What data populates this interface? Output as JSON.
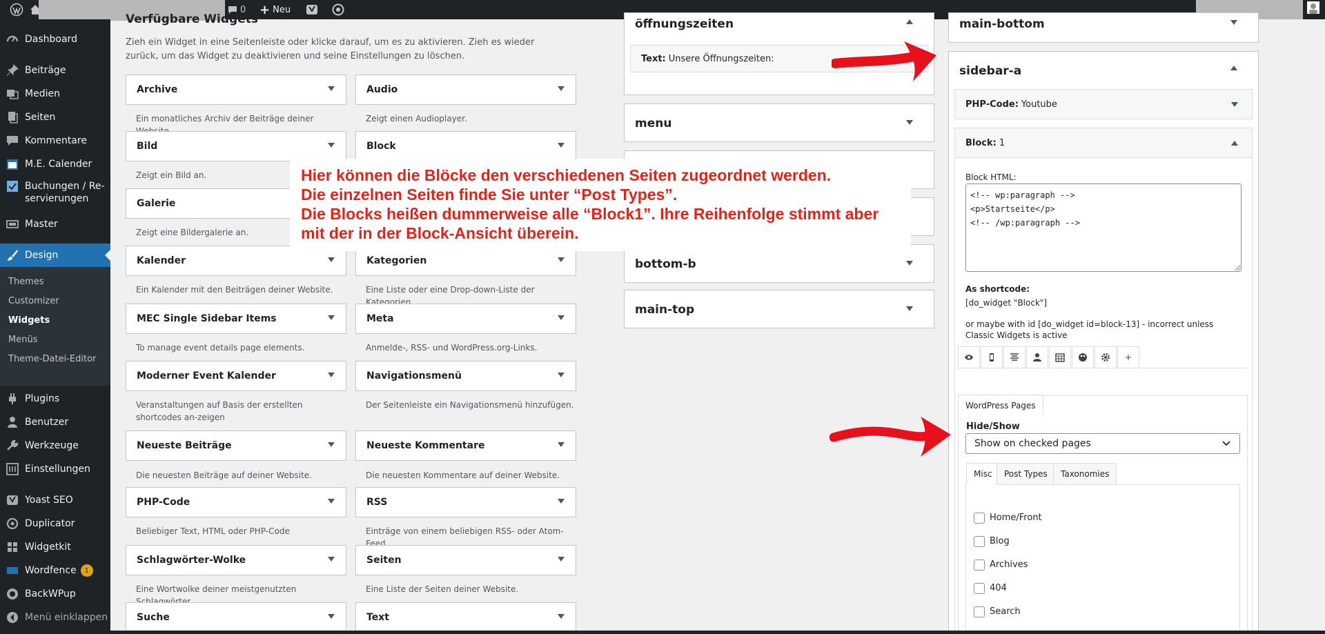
{
  "adminbar": {
    "comments": "0",
    "new_label": "Neu"
  },
  "menu": {
    "dashboard": "Dashboard",
    "posts": "Beiträge",
    "media": "Medien",
    "pages": "Seiten",
    "comments": "Kommentare",
    "mec": "M.E. Calender",
    "bookings": "Buchungen / Re-servierungen",
    "master": "Master",
    "design": "Design",
    "design_sub": {
      "themes": "Themes",
      "customizer": "Customizer",
      "widgets": "Widgets",
      "menus": "Menüs",
      "theme_editor": "Theme-Datei-Editor"
    },
    "plugins": "Plugins",
    "users": "Benutzer",
    "tools": "Werkzeuge",
    "settings": "Einstellungen",
    "yoast": "Yoast SEO",
    "duplicator": "Duplicator",
    "widgetkit": "Widgetkit",
    "wordfence": "Wordfence",
    "wordfence_badge": "1",
    "backwpup": "BackWPup",
    "collapse": "Menü einklappen"
  },
  "available": {
    "title": "Verfügbare Widgets",
    "description": "Zieh ein Widget in eine Seitenleiste oder klicke darauf, um es zu aktivieren. Zieh es wieder zurück, um das Widget zu deaktivieren und seine Einstellungen zu löschen.",
    "widgets": [
      {
        "name": "Archive",
        "desc": "Ein monatliches Archiv der Beiträge deiner Website."
      },
      {
        "name": "Audio",
        "desc": "Zeigt einen Audioplayer."
      },
      {
        "name": "Bild",
        "desc": "Zeigt ein Bild an."
      },
      {
        "name": "Block",
        "desc": ""
      },
      {
        "name": "Galerie",
        "desc": "Zeigt eine Bildergalerie an."
      },
      {
        "name": "",
        "desc": ""
      },
      {
        "name": "Kalender",
        "desc": "Ein Kalender mit den Beiträgen deiner Website."
      },
      {
        "name": "Kategorien",
        "desc": "Eine Liste oder eine Drop-down-Liste der Kategorien."
      },
      {
        "name": "MEC Single Sidebar Items",
        "desc": "To manage event details page elements."
      },
      {
        "name": "Meta",
        "desc": "Anmelde-, RSS- und WordPress.org-Links."
      },
      {
        "name": "Moderner Event Kalender",
        "desc": "Veranstaltungen auf Basis der erstellten shortcodes an-zeigen"
      },
      {
        "name": "Navigationsmenü",
        "desc": "Der Seitenleiste ein Navigationsmenü hinzufügen."
      },
      {
        "name": "Neueste Beiträge",
        "desc": "Die neuesten Beiträge auf deiner Website."
      },
      {
        "name": "Neueste Kommentare",
        "desc": "Die neuesten Kommentare auf deiner Website."
      },
      {
        "name": "PHP-Code",
        "desc": "Beliebiger Text, HTML oder PHP-Code"
      },
      {
        "name": "RSS",
        "desc": "Einträge von einem beliebigen RSS- oder Atom-Feed."
      },
      {
        "name": "Schlagwörter-Wolke",
        "desc": "Eine Wortwolke deiner meistgenutzten Schlagwörter."
      },
      {
        "name": "Seiten",
        "desc": "Eine Liste der Seiten deiner Website."
      },
      {
        "name": "Suche",
        "desc": ""
      },
      {
        "name": "Text",
        "desc": ""
      }
    ]
  },
  "middle": {
    "oeffnung": {
      "title": "öffnungszeiten",
      "widget_label": "Text:",
      "widget_title": "Unsere Öffnungszeiten:"
    },
    "menu": "menu",
    "bottom_b": "bottom-b",
    "main_top": "main-top"
  },
  "right": {
    "main_bottom": "main-bottom",
    "sidebar_a": "sidebar-a",
    "php_widget": {
      "label": "PHP-Code:",
      "title": "Youtube"
    },
    "block_widget": {
      "label": "Block:",
      "title": "1",
      "html_label": "Block HTML:",
      "html_value": "<!-- wp:paragraph -->\n<p>Startseite</p>\n<!-- /wp:paragraph -->",
      "shortcode_label": "As shortcode:",
      "shortcode": "[do_widget \"Block\"]",
      "shortcode_note": "or maybe with id [do_widget id=block-13] - incorrect unless Classic Widgets is active",
      "plus": "+"
    },
    "visibility": {
      "tab": "WordPress Pages",
      "hideshow_label": "Hide/Show",
      "select_value": "Show on checked pages",
      "tabs": [
        "Misc",
        "Post Types",
        "Taxonomies"
      ],
      "options": [
        "Home/Front",
        "Blog",
        "Archives",
        "404",
        "Search"
      ]
    }
  },
  "callout": {
    "lines": [
      "Hier können die Blöcke den verschiedenen Seiten zugeordnet werden.",
      "Die einzelnen Seiten finde Sie unter “Post Types”.",
      "Die Blocks heißen dummerweise alle “Block1”. Ihre Reihenfolge stimmt aber",
      "mit der in der Block-Ansicht überein."
    ]
  },
  "colors": {
    "accent": "#2271b1",
    "admin_dark": "#1d2327",
    "annotation_red": "#e2231a"
  }
}
